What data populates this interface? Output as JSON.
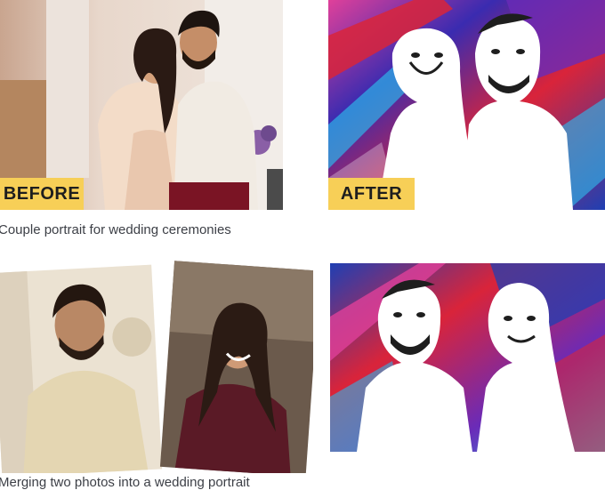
{
  "top_row": {
    "before_label": "BEFORE",
    "after_label": "AFTER",
    "caption": "Couple portrait for wedding ceremonies"
  },
  "bottom_row": {
    "caption": "Merging two photos into a wedding portrait"
  },
  "colors": {
    "badge": "#f7cf57",
    "art_red": "#d9243a",
    "art_blue": "#1f3fb3",
    "art_purple": "#6a2bb8",
    "art_pink": "#e0409a"
  }
}
